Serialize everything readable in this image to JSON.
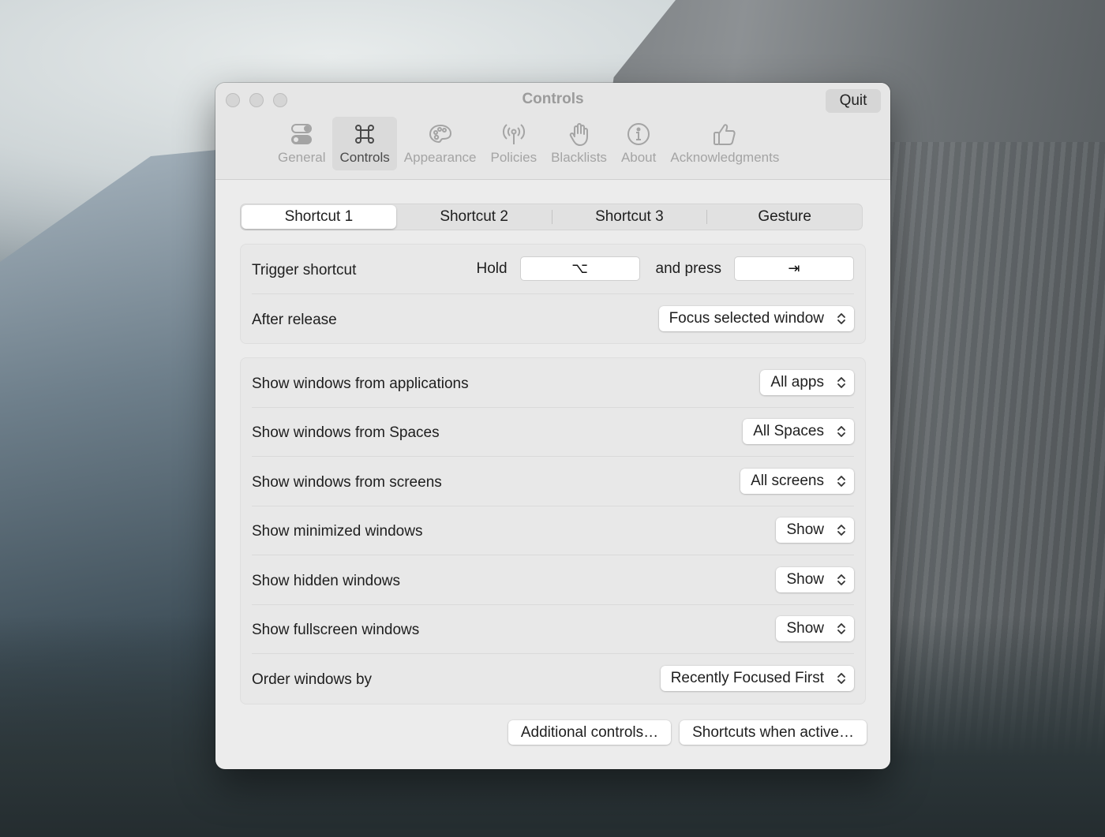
{
  "window": {
    "title": "Controls",
    "quit_label": "Quit"
  },
  "toolbar": {
    "items": [
      {
        "label": "General",
        "icon": "toggle-icon",
        "active": false
      },
      {
        "label": "Controls",
        "icon": "command-icon",
        "active": true
      },
      {
        "label": "Appearance",
        "icon": "palette-icon",
        "active": false
      },
      {
        "label": "Policies",
        "icon": "antenna-icon",
        "active": false
      },
      {
        "label": "Blacklists",
        "icon": "hand-icon",
        "active": false
      },
      {
        "label": "About",
        "icon": "info-icon",
        "active": false
      },
      {
        "label": "Acknowledgments",
        "icon": "thumbs-up-icon",
        "active": false
      }
    ]
  },
  "segments": {
    "items": [
      "Shortcut 1",
      "Shortcut 2",
      "Shortcut 3",
      "Gesture"
    ],
    "selected": "Shortcut 1"
  },
  "trigger": {
    "label": "Trigger shortcut",
    "hold_label": "Hold",
    "hold_key": "⌥",
    "press_label": "and press",
    "press_key": "⇥"
  },
  "after_release": {
    "label": "After release",
    "value": "Focus selected window"
  },
  "filters": {
    "applications": {
      "label": "Show windows from applications",
      "value": "All apps"
    },
    "spaces": {
      "label": "Show windows from Spaces",
      "value": "All Spaces"
    },
    "screens": {
      "label": "Show windows from screens",
      "value": "All screens"
    },
    "minimized": {
      "label": "Show minimized windows",
      "value": "Show"
    },
    "hidden": {
      "label": "Show hidden windows",
      "value": "Show"
    },
    "fullscreen": {
      "label": "Show fullscreen windows",
      "value": "Show"
    },
    "order": {
      "label": "Order windows by",
      "value": "Recently Focused First"
    }
  },
  "footer": {
    "additional_controls": "Additional controls…",
    "shortcuts_when_active": "Shortcuts when active…"
  }
}
